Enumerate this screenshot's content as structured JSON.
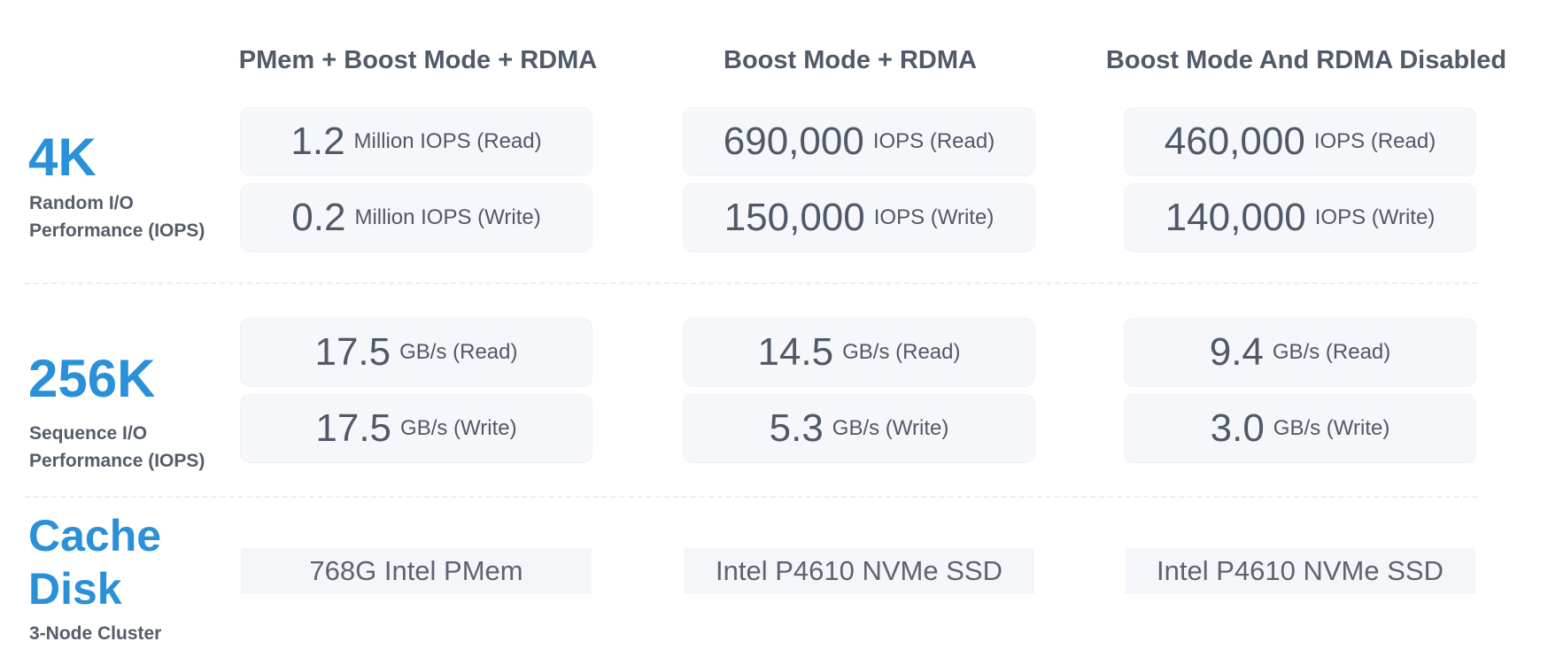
{
  "columns": [
    "PMem + Boost Mode + RDMA",
    "Boost Mode + RDMA",
    "Boost Mode And RDMA Disabled"
  ],
  "rows": {
    "random": {
      "label": "4K",
      "sub1": "Random I/O",
      "sub2": "Performance (IOPS)",
      "cells": [
        [
          {
            "value": "1.2",
            "unit": "Million IOPS (Read)"
          },
          {
            "value": "0.2",
            "unit": "Million IOPS (Write)"
          }
        ],
        [
          {
            "value": "690,000",
            "unit": "IOPS (Read)"
          },
          {
            "value": "150,000",
            "unit": "IOPS (Write)"
          }
        ],
        [
          {
            "value": "460,000",
            "unit": "IOPS (Read)"
          },
          {
            "value": "140,000",
            "unit": "IOPS (Write)"
          }
        ]
      ]
    },
    "sequence": {
      "label": "256K",
      "sub1": "Sequence I/O",
      "sub2": "Performance (IOPS)",
      "cells": [
        [
          {
            "value": "17.5",
            "unit": "GB/s (Read)"
          },
          {
            "value": "17.5",
            "unit": "GB/s (Write)"
          }
        ],
        [
          {
            "value": "14.5",
            "unit": "GB/s (Read)"
          },
          {
            "value": "5.3",
            "unit": "GB/s (Write)"
          }
        ],
        [
          {
            "value": "9.4",
            "unit": "GB/s (Read)"
          },
          {
            "value": "3.0",
            "unit": "GB/s (Write)"
          }
        ]
      ]
    },
    "cache": {
      "label1": "Cache",
      "label2": "Disk",
      "sub": "3-Node Cluster",
      "cells": [
        "768G Intel PMem",
        "Intel P4610 NVMe SSD",
        "Intel P4610 NVMe SSD"
      ]
    }
  },
  "colors": {
    "accent": "#2a90d8",
    "text": "#4f5967",
    "cell_bg": "#f6f7fa"
  }
}
